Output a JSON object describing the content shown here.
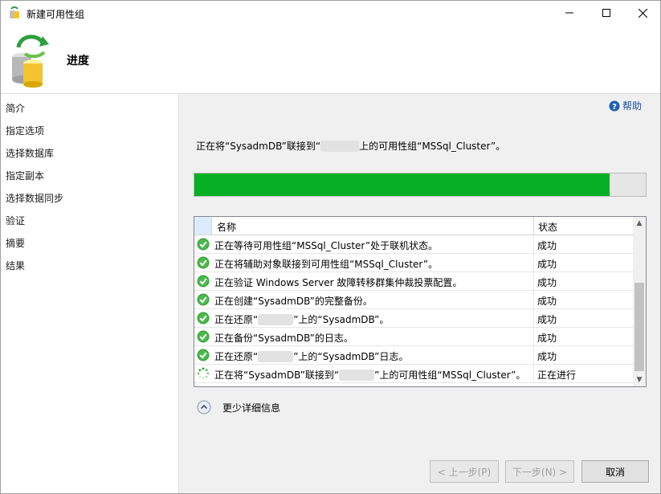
{
  "window": {
    "title": "新建可用性组",
    "minimize_icon": "minimize-icon",
    "maximize_icon": "maximize-icon",
    "close_icon": "close-icon"
  },
  "header": {
    "title": "进度"
  },
  "sidebar": {
    "items": [
      {
        "label": "简介"
      },
      {
        "label": "指定选项"
      },
      {
        "label": "选择数据库"
      },
      {
        "label": "指定副本"
      },
      {
        "label": "选择数据同步"
      },
      {
        "label": "验证"
      },
      {
        "label": "摘要"
      },
      {
        "label": "结果"
      }
    ]
  },
  "help": {
    "label": "帮助"
  },
  "status": {
    "prefix": "正在将“SysadmDB”联接到“",
    "suffix": "上的可用性组“MSSql_Cluster”。"
  },
  "progress": {
    "fraction": 0.92,
    "color": "#06b025"
  },
  "grid": {
    "columns": {
      "name": "名称",
      "status": "状态"
    },
    "rows": [
      {
        "icon": "success-check-icon",
        "name": "正在等待可用性组“MSSql_Cluster”处于联机状态。",
        "status": "成功"
      },
      {
        "icon": "success-check-icon",
        "name": "正在将辅助对象联接到可用性组“MSSql_Cluster”。",
        "status": "成功"
      },
      {
        "icon": "success-check-icon",
        "name": "正在验证 Windows Server 故障转移群集仲裁投票配置。",
        "status": "成功"
      },
      {
        "icon": "success-check-icon",
        "name": "正在创建“SysadmDB”的完整备份。",
        "status": "成功"
      },
      {
        "icon": "success-check-icon",
        "name_prefix": "正在还原“",
        "name_suffix": "”上的“SysadmDB”。",
        "status": "成功"
      },
      {
        "icon": "success-check-icon",
        "name": "正在备份“SysadmDB”的日志。",
        "status": "成功"
      },
      {
        "icon": "success-check-icon",
        "name_prefix": "正在还原“",
        "name_suffix": "”上的“SysadmDB”日志。",
        "status": "成功"
      },
      {
        "icon": "in-progress-spinner-icon",
        "name_prefix": "正在将“SysadmDB”联接到“",
        "name_suffix": "”上的可用性组“MSSql_Cluster”。",
        "status": "正在进行"
      }
    ]
  },
  "details": {
    "label": "更少详细信息",
    "icon": "collapse-details-icon"
  },
  "footer": {
    "prev_label": "< 上一步(P)",
    "next_label": "下一步(N) >",
    "cancel_label": "取消"
  }
}
